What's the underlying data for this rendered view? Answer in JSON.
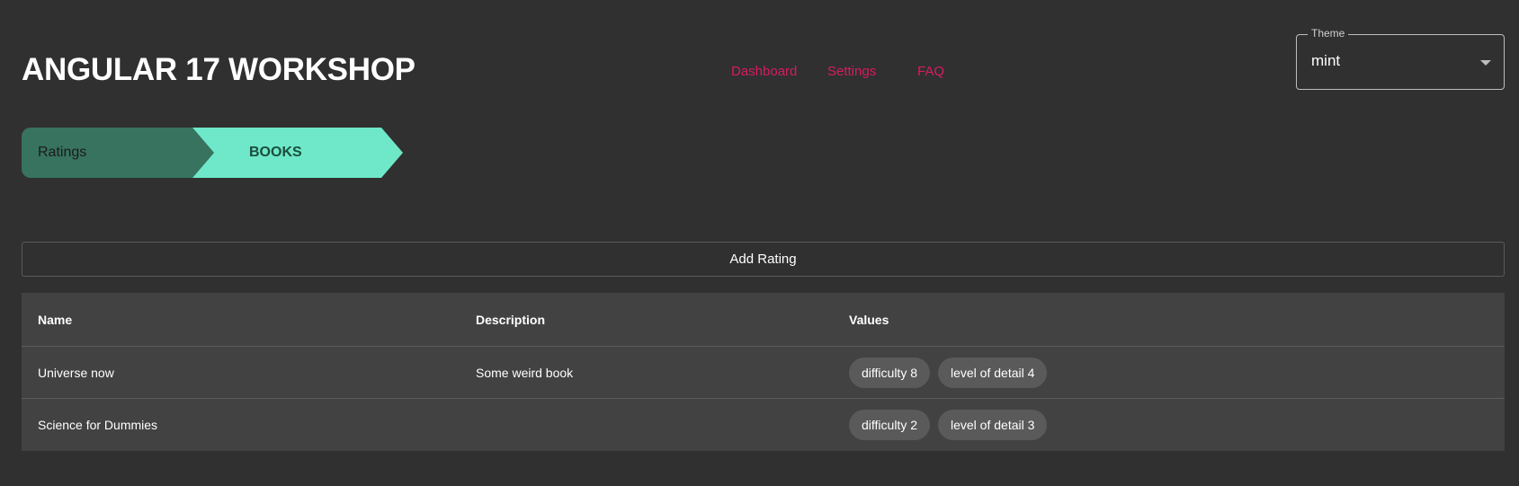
{
  "header": {
    "title": "ANGULAR 17 WORKSHOP",
    "nav": [
      "Dashboard",
      "Settings",
      "FAQ"
    ]
  },
  "theme": {
    "label": "Theme",
    "value": "mint"
  },
  "breadcrumb": {
    "items": [
      "Ratings",
      "BOOKS"
    ]
  },
  "actions": {
    "add_rating": "Add Rating"
  },
  "table": {
    "columns": [
      "Name",
      "Description",
      "Values"
    ],
    "rows": [
      {
        "name": "Universe now",
        "description": "Some weird book",
        "values": [
          "difficulty 8",
          "level of detail 4"
        ]
      },
      {
        "name": "Science for Dummies",
        "description": "",
        "values": [
          "difficulty 2",
          "level of detail 3"
        ]
      }
    ]
  },
  "colors": {
    "background": "#303030",
    "accent_link": "#d81b60",
    "crumb_dark": "#37735f",
    "crumb_light": "#6ee8c8",
    "table_bg": "#424242",
    "chip_bg": "#5a5a5a"
  }
}
